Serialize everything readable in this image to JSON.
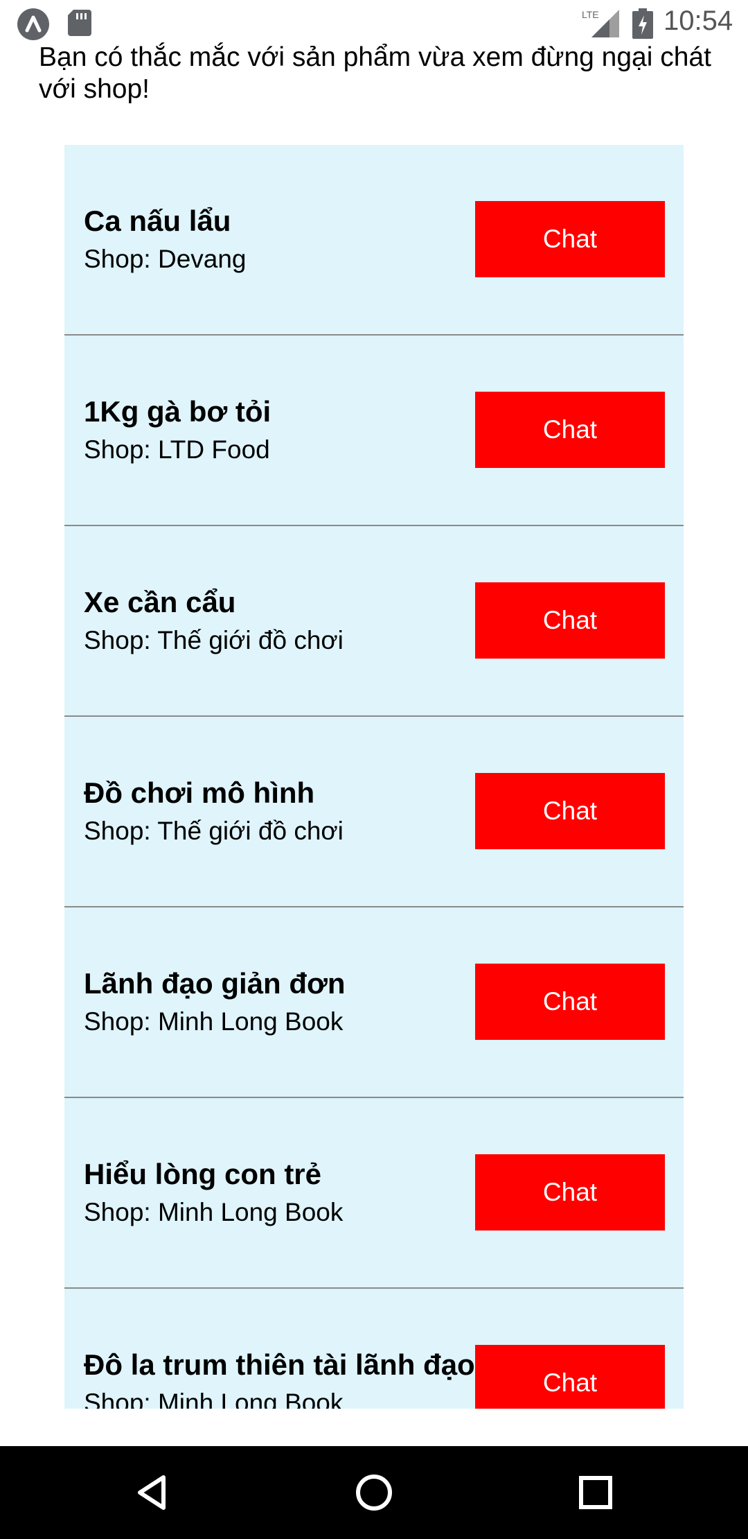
{
  "status_bar": {
    "time": "10:54",
    "network_label": "LTE",
    "icons": [
      "app-icon",
      "sd-card-icon",
      "signal-icon",
      "battery-charging-icon"
    ]
  },
  "intro_text": "Bạn có thắc mắc với sản phẩm vừa xem đừng ngại chát với shop!",
  "items": [
    {
      "name": "Ca nấu lẩu",
      "shop": "Shop: Devang",
      "button": "Chat"
    },
    {
      "name": "1Kg gà bơ tỏi",
      "shop": "Shop: LTD Food",
      "button": "Chat"
    },
    {
      "name": "Xe cần cẩu",
      "shop": "Shop: Thế giới đồ chơi",
      "button": "Chat"
    },
    {
      "name": "Đồ chơi mô hình",
      "shop": "Shop: Thế giới đồ chơi",
      "button": "Chat"
    },
    {
      "name": "Lãnh đạo giản đơn",
      "shop": "Shop: Minh Long Book",
      "button": "Chat"
    },
    {
      "name": "Hiểu lòng con trẻ",
      "shop": "Shop: Minh Long Book",
      "button": "Chat"
    },
    {
      "name": "Đô la trum thiên tài lãnh đạo",
      "shop": "Shop: Minh Long Book",
      "button": "Chat"
    }
  ],
  "colors": {
    "list_background": "#dff4fb",
    "button_background": "#ff0000",
    "button_text": "#ffffff",
    "divider": "#8a8a8a"
  },
  "nav_bar": {
    "icons": [
      "back-icon",
      "home-icon",
      "recents-icon"
    ]
  }
}
